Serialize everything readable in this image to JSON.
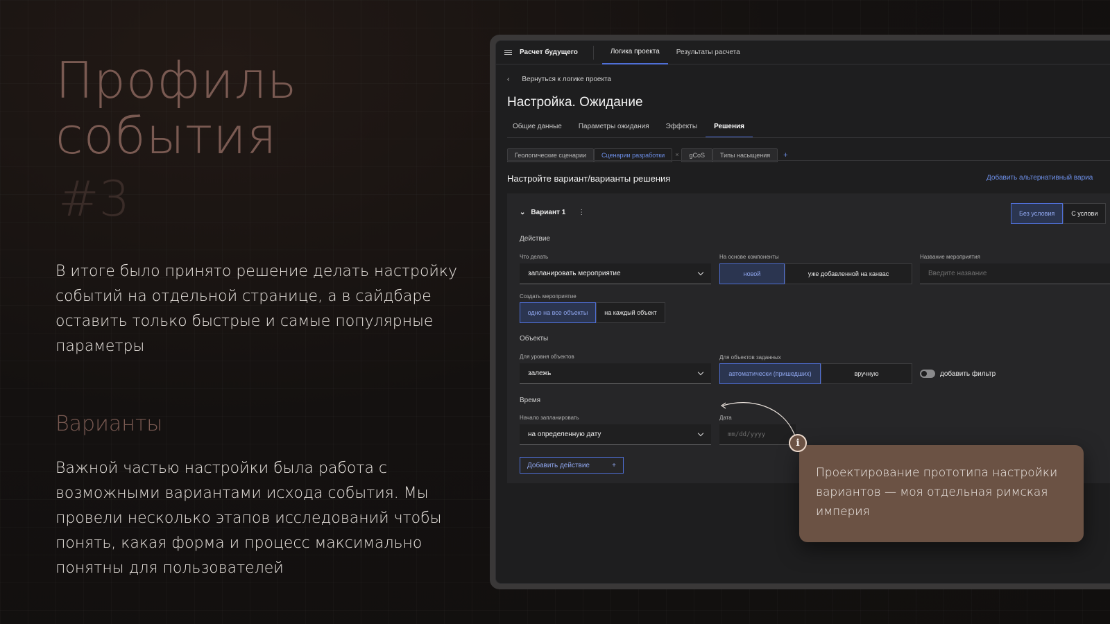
{
  "slide": {
    "title_line1": "Профиль",
    "title_line2": "события",
    "number": "#3",
    "lead": "В итоге было принято решение делать настройку событий на отдельной странице, а в сайдбаре оставить только быстрые и самые популярные параметры",
    "subtitle": "Варианты",
    "body": "Важной частью настройки была работа с возможными вариантами исхода события. Мы провели несколько этапов исследований чтобы понять, какая форма и процесс максимально понятны для пользователей",
    "callout": "Проектирование прототипа настройки вариантов — моя отдельная римская империя",
    "callout_icon": "i"
  },
  "app": {
    "title": "Расчет будущего",
    "top_tabs": [
      "Логика проекта",
      "Результаты расчета"
    ],
    "back_link": "Вернуться к логике проекта",
    "page_title": "Настройка. Ожидание",
    "tabs": [
      "Общие данные",
      "Параметры ожидания",
      "Эффекты",
      "Решения"
    ],
    "chips": [
      "Геологические сценарии",
      "Сценарии разработки",
      "gCoS",
      "Типы насыщения"
    ],
    "chip_close": "×",
    "chip_add": "+",
    "section_title": "Настройте вариант/варианты решения",
    "add_alternative": "Добавить альтернативный вариа",
    "variant": {
      "name": "Вариант 1",
      "menu": "⋮",
      "condition_options": [
        "Без условия",
        "С услови"
      ],
      "action_header": "Действие",
      "what_label": "Что делать",
      "what_value": "запланировать мероприятие",
      "based_label": "На основе компоненты",
      "based_options": [
        "новой",
        "уже добавленной на канвас"
      ],
      "name_label": "Название мероприятия",
      "name_placeholder": "Введите название",
      "create_label": "Создать мероприятие",
      "create_options": [
        "одно на все объекты",
        "на каждый объект"
      ],
      "objects_header": "Объекты",
      "level_label": "Для уровня объектов",
      "level_value": "залежь",
      "given_label": "Для объектов заданных",
      "given_options": [
        "автоматически (пришедших)",
        "вручную"
      ],
      "filter_label": "добавить фильтр",
      "time_header": "Время",
      "start_label": "Начало запланировать",
      "start_value": "на определенную дату",
      "date_label": "Дата",
      "date_placeholder": "mm/dd/yyyy",
      "add_action": "Добавить действие",
      "add_action_icon": "+"
    }
  },
  "colors": {
    "accent": "#4f6fd6",
    "title_brown": "#7a5a52",
    "callout_bg": "#6b5244"
  }
}
